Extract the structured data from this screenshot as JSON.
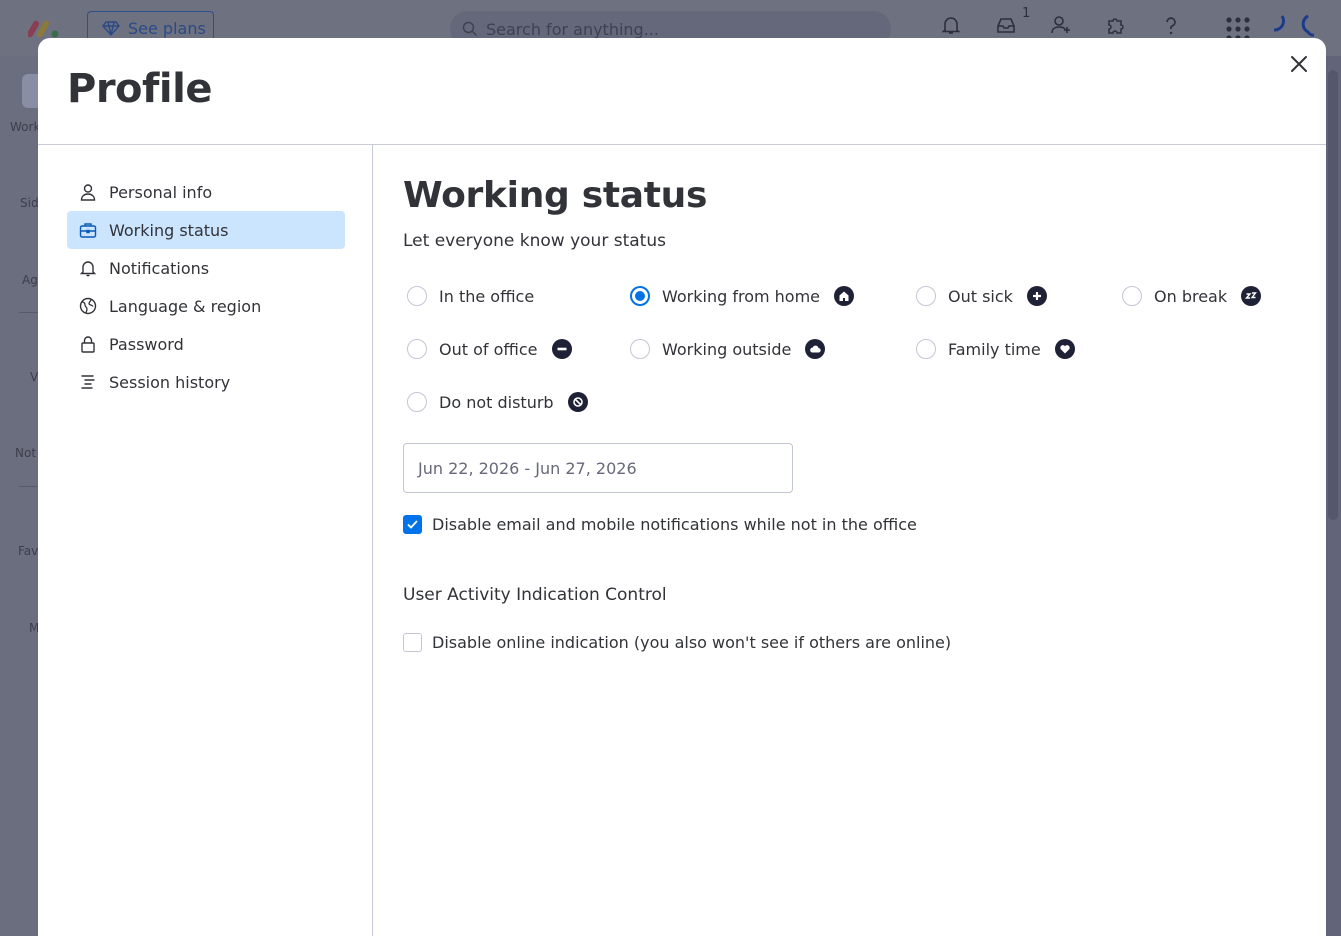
{
  "topbar": {
    "see_plans_label": "See plans",
    "search_placeholder": "Search for anything...",
    "inbox_count": "1"
  },
  "bg_sidebar": {
    "labels": [
      "Work",
      "Sid",
      "Ag",
      "V",
      "Not",
      "Fav",
      "M"
    ]
  },
  "modal": {
    "title": "Profile",
    "close_icon": "close-icon"
  },
  "nav": {
    "items": [
      {
        "label": "Personal info",
        "icon": "person-icon",
        "active": false
      },
      {
        "label": "Working status",
        "icon": "briefcase-icon",
        "active": true
      },
      {
        "label": "Notifications",
        "icon": "bell-icon",
        "active": false
      },
      {
        "label": "Language & region",
        "icon": "globe-icon",
        "active": false
      },
      {
        "label": "Password",
        "icon": "lock-icon",
        "active": false
      },
      {
        "label": "Session history",
        "icon": "lines-icon",
        "active": false
      }
    ]
  },
  "content": {
    "title": "Working status",
    "subtitle": "Let everyone know your status",
    "statuses": [
      {
        "label": "In the office",
        "checked": false,
        "icon": ""
      },
      {
        "label": "Working from home",
        "checked": true,
        "icon": "home-icon"
      },
      {
        "label": "Out sick",
        "checked": false,
        "icon": "plus-icon"
      },
      {
        "label": "On break",
        "checked": false,
        "icon": "sleep-icon"
      },
      {
        "label": "Out of office",
        "checked": false,
        "icon": "minus-icon"
      },
      {
        "label": "Working outside",
        "checked": false,
        "icon": "cloud-icon"
      },
      {
        "label": "Family time",
        "checked": false,
        "icon": "heart-icon"
      },
      {
        "label": "Do not disturb",
        "checked": false,
        "icon": "no-icon"
      }
    ],
    "date_range": "Jun 22, 2026 - Jun 27, 2026",
    "disable_notifications": {
      "label": "Disable email and mobile notifications while not in the office",
      "checked": true
    },
    "activity_section_title": "User Activity Indication Control",
    "disable_online": {
      "label": "Disable online indication (you also won't see if others are online)",
      "checked": false
    }
  },
  "colors": {
    "accent": "#0073ea",
    "active_nav_bg": "#cce5ff",
    "text": "#323338",
    "status_icon_bg": "#1f2136"
  }
}
